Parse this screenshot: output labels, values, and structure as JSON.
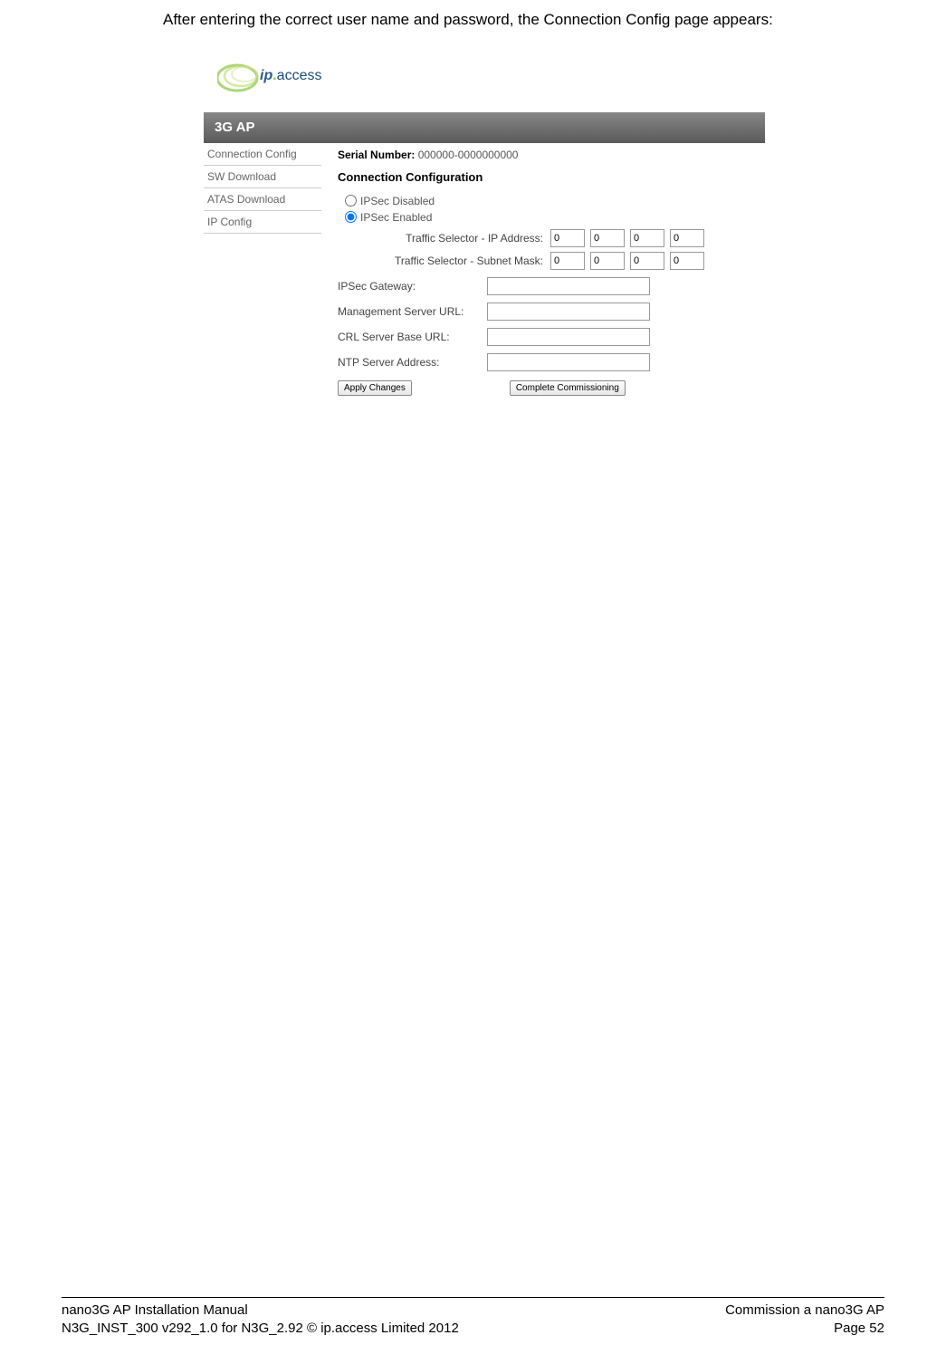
{
  "intro_text": "After entering the correct user name and password, the Connection Config page appears:",
  "logo": {
    "ip": "ip",
    "dot": ".",
    "access": "access"
  },
  "title_bar": "3G AP",
  "sidebar": {
    "items": [
      {
        "label": "Connection Config"
      },
      {
        "label": "SW Download"
      },
      {
        "label": "ATAS Download"
      },
      {
        "label": "IP Config"
      }
    ]
  },
  "content": {
    "serial_label": "Serial Number:",
    "serial_value": "000000-0000000000",
    "section_heading": "Connection Configuration",
    "ipsec_disabled_label": "IPSec Disabled",
    "ipsec_enabled_label": "IPSec Enabled",
    "traffic_ip_label": "Traffic Selector - IP Address:",
    "traffic_ip": [
      "0",
      "0",
      "0",
      "0"
    ],
    "traffic_mask_label": "Traffic Selector - Subnet Mask:",
    "traffic_mask": [
      "0",
      "0",
      "0",
      "0"
    ],
    "ipsec_gateway_label": "IPSec Gateway:",
    "ipsec_gateway_value": "",
    "mgmt_url_label": "Management Server URL:",
    "mgmt_url_value": "",
    "crl_url_label": "CRL Server Base URL:",
    "crl_url_value": "",
    "ntp_label": "NTP Server Address:",
    "ntp_value": "",
    "apply_button": "Apply Changes",
    "complete_button": "Complete Commissioning"
  },
  "footer": {
    "left_line1": "nano3G AP Installation Manual",
    "left_line2": "N3G_INST_300 v292_1.0 for N3G_2.92 © ip.access Limited 2012",
    "right_line1": "Commission a nano3G AP",
    "right_line2": "Page 52"
  }
}
